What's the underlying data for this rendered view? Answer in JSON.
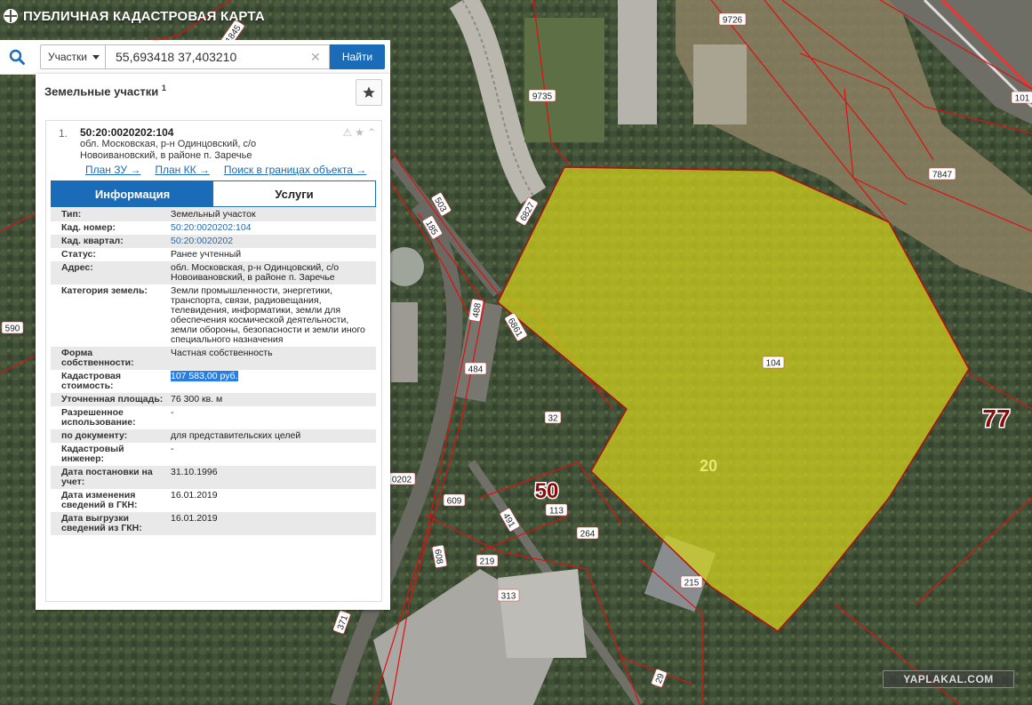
{
  "header": {
    "title": "ПУБЛИЧНАЯ КАДАСТРОВАЯ КАРТА"
  },
  "search": {
    "type_label": "Участки",
    "query": "55,693418 37,403210",
    "find_label": "Найти"
  },
  "panel": {
    "title": "Земельные участки",
    "count": "1",
    "result": {
      "index": "1.",
      "cad_number": "50:20:0020202:104",
      "address": "обл. Московская, р-н Одинцовский, с/о Новоивановский, в районе п. Заречье",
      "links": [
        "План ЗУ →",
        "План КК →",
        "Поиск в границах объекта →"
      ]
    },
    "tabs": [
      "Информация",
      "Услуги"
    ],
    "rows": [
      {
        "k": "Тип:",
        "v": "Земельный участок"
      },
      {
        "k": "Кад. номер:",
        "v": "50:20:0020202:104"
      },
      {
        "k": "Кад. квартал:",
        "v": "50:20:0020202"
      },
      {
        "k": "Статус:",
        "v": "Ранее учтенный"
      },
      {
        "k": "Адрес:",
        "v": "обл. Московская, р-н Одинцовский, с/о Новоивановский, в районе п. Заречье"
      },
      {
        "k": "Категория земель:",
        "v": "Земли промышленности, энергетики, транспорта, связи, радиовещания, телевидения, информатики, земли для обеспечения космической деятельности, земли обороны, безопасности и земли иного специального назначения"
      },
      {
        "k": "Форма собственности:",
        "v": "Частная собственность"
      },
      {
        "k": "Кадастровая стоимость:",
        "v": "107 583,00 руб."
      },
      {
        "k": "Уточненная площадь:",
        "v": "76 300 кв. м"
      },
      {
        "k": "Разрешенное использование:",
        "v": "-"
      },
      {
        "k": "по документу:",
        "v": "для представительских целей"
      },
      {
        "k": "Кадастровый инженер:",
        "v": "-"
      },
      {
        "k": "Дата постановки на учет:",
        "v": "31.10.1996"
      },
      {
        "k": "Дата изменения сведений в ГКН:",
        "v": "16.01.2019"
      },
      {
        "k": "Дата выгрузки сведений из ГКН:",
        "v": "16.01.2019"
      }
    ]
  },
  "map": {
    "labels_small": [
      "1845",
      "9726",
      "9735",
      "101",
      "503",
      "6827",
      "7847",
      "185",
      "590",
      "488",
      "6861",
      "104",
      "484",
      "32",
      "0202",
      "609",
      "113",
      "491",
      "264",
      "608",
      "219",
      "313",
      "215",
      "371",
      "29"
    ],
    "labels_big": [
      "77",
      "50",
      "20"
    ],
    "colors": {
      "parcel_fill": "#d4d41a",
      "parcel_stroke": "#b01010",
      "boundary": "#d11"
    }
  },
  "watermark": "YAPLAKAL.COM"
}
